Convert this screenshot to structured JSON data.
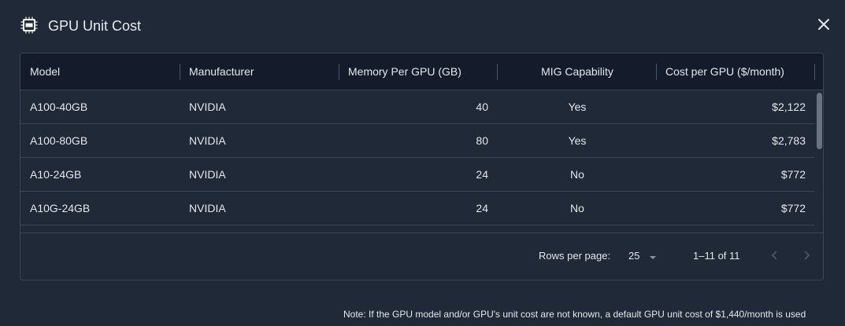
{
  "dialog": {
    "title": "GPU Unit Cost",
    "icon": "gpu-chip-icon",
    "close_icon": "close-icon"
  },
  "table": {
    "columns": [
      "Model",
      "Manufacturer",
      "Memory Per GPU (GB)",
      "MIG Capability",
      "Cost per GPU ($/month)"
    ],
    "rows": [
      [
        "A100-40GB",
        "NVIDIA",
        "40",
        "Yes",
        "$2,122"
      ],
      [
        "A100-80GB",
        "NVIDIA",
        "80",
        "Yes",
        "$2,783"
      ],
      [
        "A10-24GB",
        "NVIDIA",
        "24",
        "No",
        "$772"
      ],
      [
        "A10G-24GB",
        "NVIDIA",
        "24",
        "No",
        "$772"
      ]
    ]
  },
  "pagination": {
    "rows_per_page_label": "Rows per page:",
    "rows_per_page_value": "25",
    "range": "1–11 of 11",
    "prev_icon": "chevron-left-icon",
    "next_icon": "chevron-right-icon"
  },
  "note": "Note: If the GPU model and/or GPU's unit cost are not known, a default GPU unit cost of $1,440/month is used",
  "colors": {
    "background": "#1f2937",
    "header_background": "#141c2b",
    "border": "#3a4555",
    "text": "#e5e7eb"
  }
}
